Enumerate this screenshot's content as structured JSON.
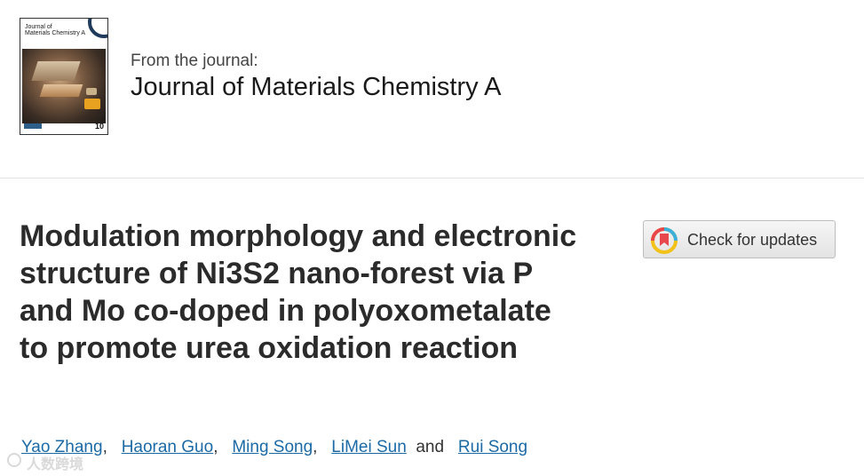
{
  "journal": {
    "cover_title": "Journal of\nMaterials Chemistry A",
    "from_label": "From the journal:",
    "name": "Journal of Materials Chemistry A"
  },
  "article": {
    "title": "Modulation morphology and electronic structure of Ni3S2 nano-forest via P and Mo co-doped in polyoxometalate to promote urea oxidation reaction"
  },
  "check_updates": {
    "label": "Check for updates"
  },
  "authors": [
    {
      "name": "Yao Zhang",
      "sep": ","
    },
    {
      "name": "Haoran Guo",
      "sep": ","
    },
    {
      "name": "Ming Song",
      "sep": ","
    },
    {
      "name": "LiMei Sun",
      "sep": "and"
    },
    {
      "name": "Rui Song",
      "sep": ""
    }
  ],
  "watermark": {
    "text": "人数跨境"
  },
  "colors": {
    "link": "#1b6aa5",
    "title": "#2b2b2b",
    "divider": "#e2e2e2"
  }
}
